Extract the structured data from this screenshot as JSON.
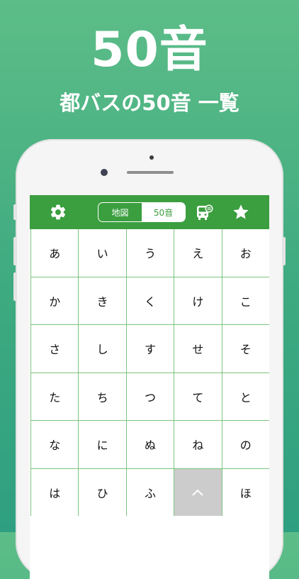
{
  "promo": {
    "headline": "50音",
    "subheadline": "都バスの50音 一覧"
  },
  "navbar": {
    "settings_icon": "gear-icon",
    "segment": {
      "options": [
        "地図",
        "50音"
      ],
      "selected": "50音"
    },
    "bus_icon": "bus-stop-icon",
    "favorites_icon": "star-icon"
  },
  "kana_grid": {
    "rows": [
      [
        "あ",
        "い",
        "う",
        "え",
        "お"
      ],
      [
        "か",
        "き",
        "く",
        "け",
        "こ"
      ],
      [
        "さ",
        "し",
        "す",
        "せ",
        "そ"
      ],
      [
        "た",
        "ち",
        "つ",
        "て",
        "と"
      ],
      [
        "な",
        "に",
        "ぬ",
        "ね",
        "の"
      ],
      [
        "は",
        "ひ",
        "ふ",
        "^",
        "ほ"
      ]
    ],
    "highlight_cell": "^"
  },
  "colors": {
    "brand_green": "#3b9e3f",
    "grid_line": "#7cc47e",
    "background_top": "#5dbd88",
    "background_bottom": "#2e9f80"
  }
}
